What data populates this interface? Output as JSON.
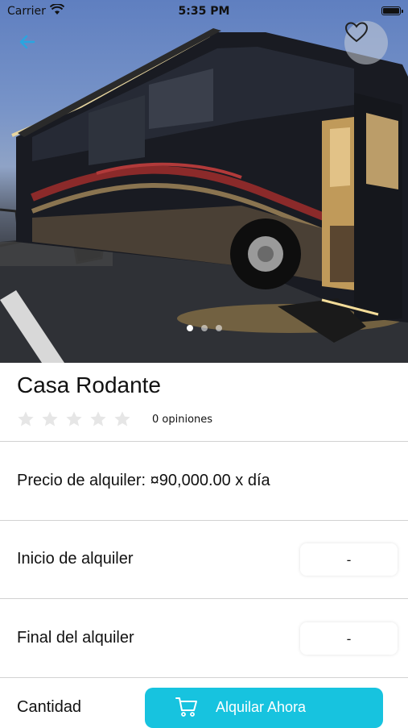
{
  "status_bar": {
    "carrier": "Carrier",
    "time": "5:35 PM"
  },
  "gallery": {
    "image_count": 3,
    "active_index": 0
  },
  "product": {
    "title": "Casa Rodante",
    "rating": 0,
    "rating_max": 5,
    "reviews_label": "0 opiniones"
  },
  "price": {
    "label": "Precio de alquiler: ¤90,000.00 x día"
  },
  "rental_start": {
    "label": "Inicio de alquiler",
    "value": "-"
  },
  "rental_end": {
    "label": "Final del alquiler",
    "value": "-"
  },
  "footer": {
    "quantity_label": "Cantidad",
    "rent_button_label": "Alquilar Ahora"
  },
  "colors": {
    "accent": "#17c3df",
    "back_arrow": "#2aa5e0",
    "star_empty": "#e6e6e6"
  },
  "icons": {
    "back": "arrow-left-icon",
    "favorite": "heart-outline-icon",
    "cart": "cart-icon",
    "star": "star-icon"
  }
}
